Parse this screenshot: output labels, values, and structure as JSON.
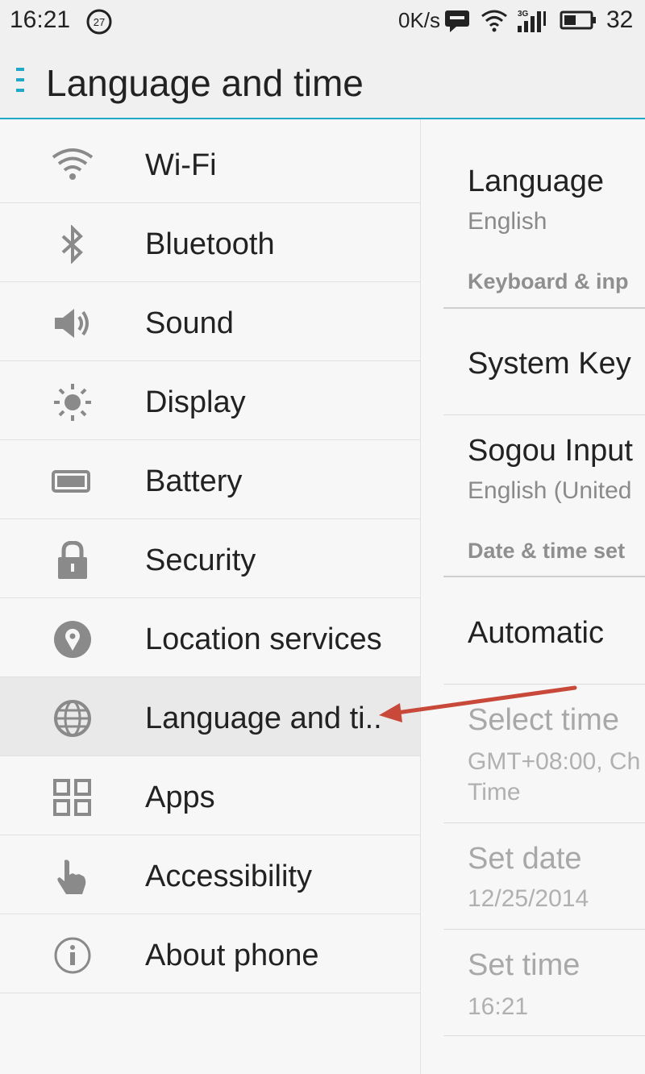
{
  "status_bar": {
    "time": "16:21",
    "notification_badge": "27",
    "net_speed": "0K/s",
    "battery_pct": "32",
    "icons": [
      "message-icon",
      "wifi-icon",
      "3g-signal-icon",
      "battery-icon"
    ]
  },
  "header": {
    "title": "Language and time"
  },
  "nav": {
    "items": [
      {
        "label": "Wi-Fi",
        "icon": "wifi-icon"
      },
      {
        "label": "Bluetooth",
        "icon": "bluetooth-icon"
      },
      {
        "label": "Sound",
        "icon": "speaker-icon"
      },
      {
        "label": "Display",
        "icon": "brightness-icon"
      },
      {
        "label": "Battery",
        "icon": "battery-icon"
      },
      {
        "label": "Security",
        "icon": "lock-icon"
      },
      {
        "label": "Location services",
        "icon": "location-pin-icon"
      },
      {
        "label": "Language and ti..",
        "icon": "globe-icon",
        "selected": true
      },
      {
        "label": "Apps",
        "icon": "apps-grid-icon"
      },
      {
        "label": "Accessibility",
        "icon": "hand-pointer-icon"
      },
      {
        "label": "About phone",
        "icon": "info-icon"
      }
    ]
  },
  "detail": {
    "language": {
      "title": "Language",
      "value": "English"
    },
    "keyboard_header": "Keyboard & inp",
    "system_keyboard": {
      "title": "System Key"
    },
    "sogou": {
      "title": "Sogou Input",
      "value": "English (United"
    },
    "datetime_header": "Date & time set",
    "automatic": {
      "title": "Automatic"
    },
    "select_time": {
      "title": "Select time",
      "value1": "GMT+08:00, Ch",
      "value2": "Time"
    },
    "set_date": {
      "title": "Set date",
      "value": "12/25/2014"
    },
    "set_time": {
      "title": "Set time",
      "value": "16:21"
    }
  },
  "colors": {
    "accent": "#1fa8c8",
    "annotation_arrow": "#c8483a"
  }
}
